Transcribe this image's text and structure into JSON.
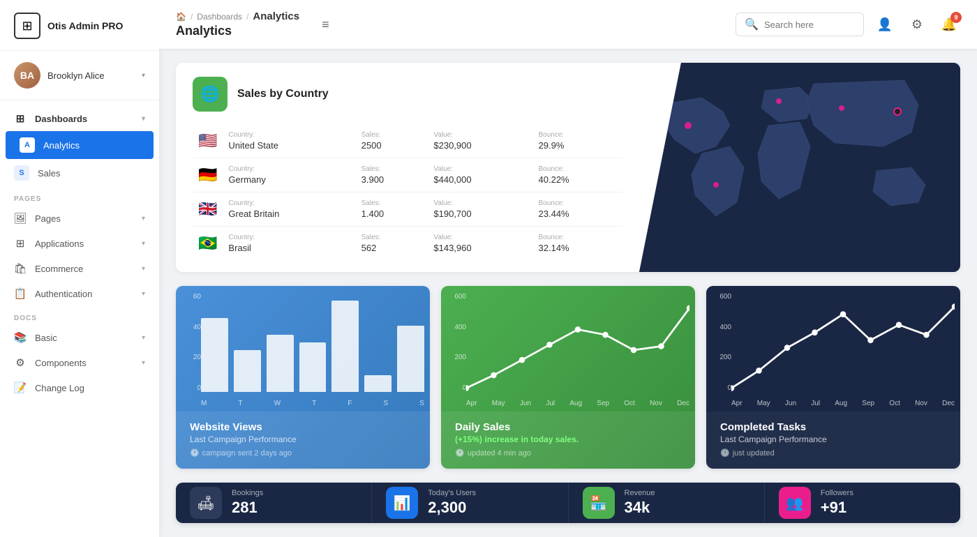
{
  "app": {
    "name": "Otis Admin PRO",
    "logo_symbol": "⊞"
  },
  "user": {
    "name": "Brooklyn Alice",
    "initials": "BA"
  },
  "sidebar": {
    "sections": [
      {
        "items": [
          {
            "id": "dashboards",
            "label": "Dashboards",
            "icon": "⊞",
            "active": false,
            "parent": true,
            "chevron": true
          },
          {
            "id": "analytics",
            "label": "Analytics",
            "icon": "A",
            "active": true,
            "parent": false
          },
          {
            "id": "sales",
            "label": "Sales",
            "icon": "S",
            "active": false,
            "parent": false
          }
        ]
      },
      {
        "label": "PAGES",
        "items": [
          {
            "id": "pages",
            "label": "Pages",
            "icon": "🖼",
            "active": false,
            "chevron": true
          },
          {
            "id": "applications",
            "label": "Applications",
            "icon": "⊞",
            "active": false,
            "chevron": true
          },
          {
            "id": "ecommerce",
            "label": "Ecommerce",
            "icon": "🛍",
            "active": false,
            "chevron": true
          },
          {
            "id": "authentication",
            "label": "Authentication",
            "icon": "📋",
            "active": false,
            "chevron": true
          }
        ]
      },
      {
        "label": "DOCS",
        "items": [
          {
            "id": "basic",
            "label": "Basic",
            "icon": "📚",
            "active": false,
            "chevron": true
          },
          {
            "id": "components",
            "label": "Components",
            "icon": "⚙",
            "active": false,
            "chevron": true
          },
          {
            "id": "changelog",
            "label": "Change Log",
            "icon": "📝",
            "active": false
          }
        ]
      }
    ]
  },
  "header": {
    "breadcrumb_home": "🏠",
    "breadcrumb_parent": "Dashboards",
    "breadcrumb_current": "Analytics",
    "page_title": "Analytics",
    "search_placeholder": "Search here",
    "notification_count": "9",
    "menu_icon": "≡"
  },
  "sales_country": {
    "title": "Sales by Country",
    "countries": [
      {
        "flag": "🇺🇸",
        "country_label": "Country:",
        "country": "United State",
        "sales_label": "Sales:",
        "sales": "2500",
        "value_label": "Value:",
        "value": "$230,900",
        "bounce_label": "Bounce:",
        "bounce": "29.9%"
      },
      {
        "flag": "🇩🇪",
        "country_label": "Country:",
        "country": "Germany",
        "sales_label": "Sales:",
        "sales": "3.900",
        "value_label": "Value:",
        "value": "$440,000",
        "bounce_label": "Bounce:",
        "bounce": "40.22%"
      },
      {
        "flag": "🇬🇧",
        "country_label": "Country:",
        "country": "Great Britain",
        "sales_label": "Sales:",
        "sales": "1.400",
        "value_label": "Value:",
        "value": "$190,700",
        "bounce_label": "Bounce:",
        "bounce": "23.44%"
      },
      {
        "flag": "🇧🇷",
        "country_label": "Country:",
        "country": "Brasil",
        "sales_label": "Sales:",
        "sales": "562",
        "value_label": "Value:",
        "value": "$143,960",
        "bounce_label": "Bounce:",
        "bounce": "32.14%"
      }
    ]
  },
  "website_views": {
    "title": "Website Views",
    "subtitle": "Last Campaign Performance",
    "footer": "campaign sent 2 days ago",
    "y_labels": [
      "60",
      "40",
      "20",
      "0"
    ],
    "x_labels": [
      "M",
      "T",
      "W",
      "T",
      "F",
      "S",
      "S"
    ],
    "bars": [
      45,
      25,
      35,
      30,
      55,
      10,
      40
    ]
  },
  "daily_sales": {
    "title": "Daily Sales",
    "subtitle_prefix": "(+15%)",
    "subtitle_text": " increase in today sales.",
    "footer": "updated 4 min ago",
    "y_labels": [
      "600",
      "400",
      "200",
      "0"
    ],
    "x_labels": [
      "Apr",
      "May",
      "Jun",
      "Jul",
      "Aug",
      "Sep",
      "Oct",
      "Nov",
      "Dec"
    ],
    "points": [
      20,
      80,
      200,
      320,
      420,
      370,
      280,
      310,
      500
    ]
  },
  "completed_tasks": {
    "title": "Completed Tasks",
    "subtitle": "Last Campaign Performance",
    "footer": "just updated",
    "y_labels": [
      "600",
      "400",
      "200",
      "0"
    ],
    "x_labels": [
      "Apr",
      "May",
      "Jun",
      "Jul",
      "Aug",
      "Sep",
      "Oct",
      "Nov",
      "Dec"
    ],
    "points": [
      30,
      120,
      280,
      380,
      480,
      340,
      420,
      360,
      500
    ]
  },
  "stats": [
    {
      "icon": "🛋",
      "icon_style": "dark",
      "label": "Bookings",
      "value": "281"
    },
    {
      "icon": "📊",
      "icon_style": "blue",
      "label": "Today's Users",
      "value": "2,300"
    },
    {
      "icon": "🏪",
      "icon_style": "green",
      "label": "Revenue",
      "value": "34k"
    },
    {
      "icon": "👥",
      "icon_style": "pink",
      "label": "Followers",
      "value": "+91"
    }
  ]
}
